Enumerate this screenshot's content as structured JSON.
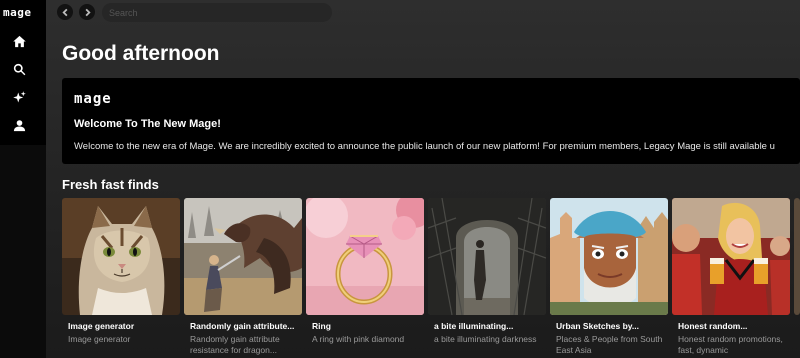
{
  "sidebar": {
    "logo": "mage",
    "items": [
      {
        "icon": "home-icon",
        "label": "Home"
      },
      {
        "icon": "search-icon",
        "label": "Search"
      },
      {
        "icon": "sparkle-icon",
        "label": "Create"
      },
      {
        "icon": "user-icon",
        "label": "Profile"
      }
    ]
  },
  "topbar": {
    "search_placeholder": "Search"
  },
  "main": {
    "greeting": "Good afternoon",
    "banner": {
      "logo": "mage",
      "title": "Welcome To The New Mage!",
      "text": "Welcome to the new era of Mage. We are incredibly excited to announce the public launch of our new platform! For premium members, Legacy Mage is still available u"
    },
    "section_title": "Fresh fast finds",
    "cards": [
      {
        "title": "Image generator",
        "description": "Image generator"
      },
      {
        "title": "Randomly gain attribute...",
        "description": "Randomly gain attribute resistance for dragon..."
      },
      {
        "title": "Ring",
        "description": "A ring with pink diamond"
      },
      {
        "title": "a bite illuminating...",
        "description": "a bite illuminating darkness"
      },
      {
        "title": "Urban Sketches by...",
        "description": "Places & People from South East Asia"
      },
      {
        "title": "Honest random...",
        "description": "Honest random promotions, fast, dynamic"
      }
    ]
  },
  "colors": {
    "background": "#000000",
    "main_bg": "#262626",
    "card_desc": "#9a9a9a"
  }
}
